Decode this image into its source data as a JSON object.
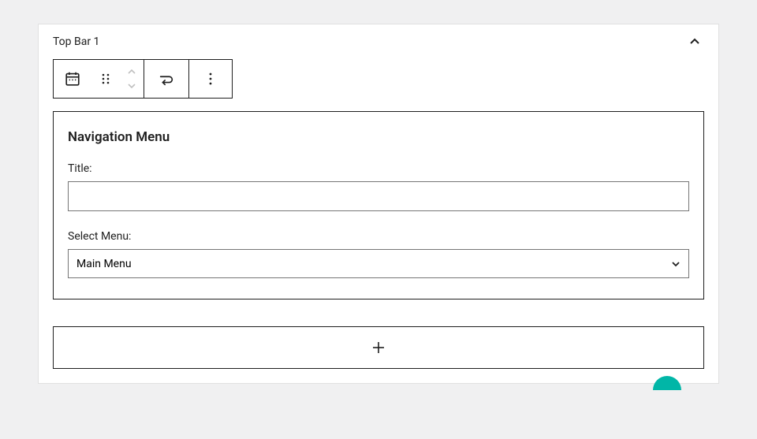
{
  "panel": {
    "title": "Top Bar 1"
  },
  "widget": {
    "heading": "Navigation Menu",
    "title_label": "Title:",
    "title_value": "",
    "select_label": "Select Menu:",
    "select_value": "Main Menu"
  }
}
